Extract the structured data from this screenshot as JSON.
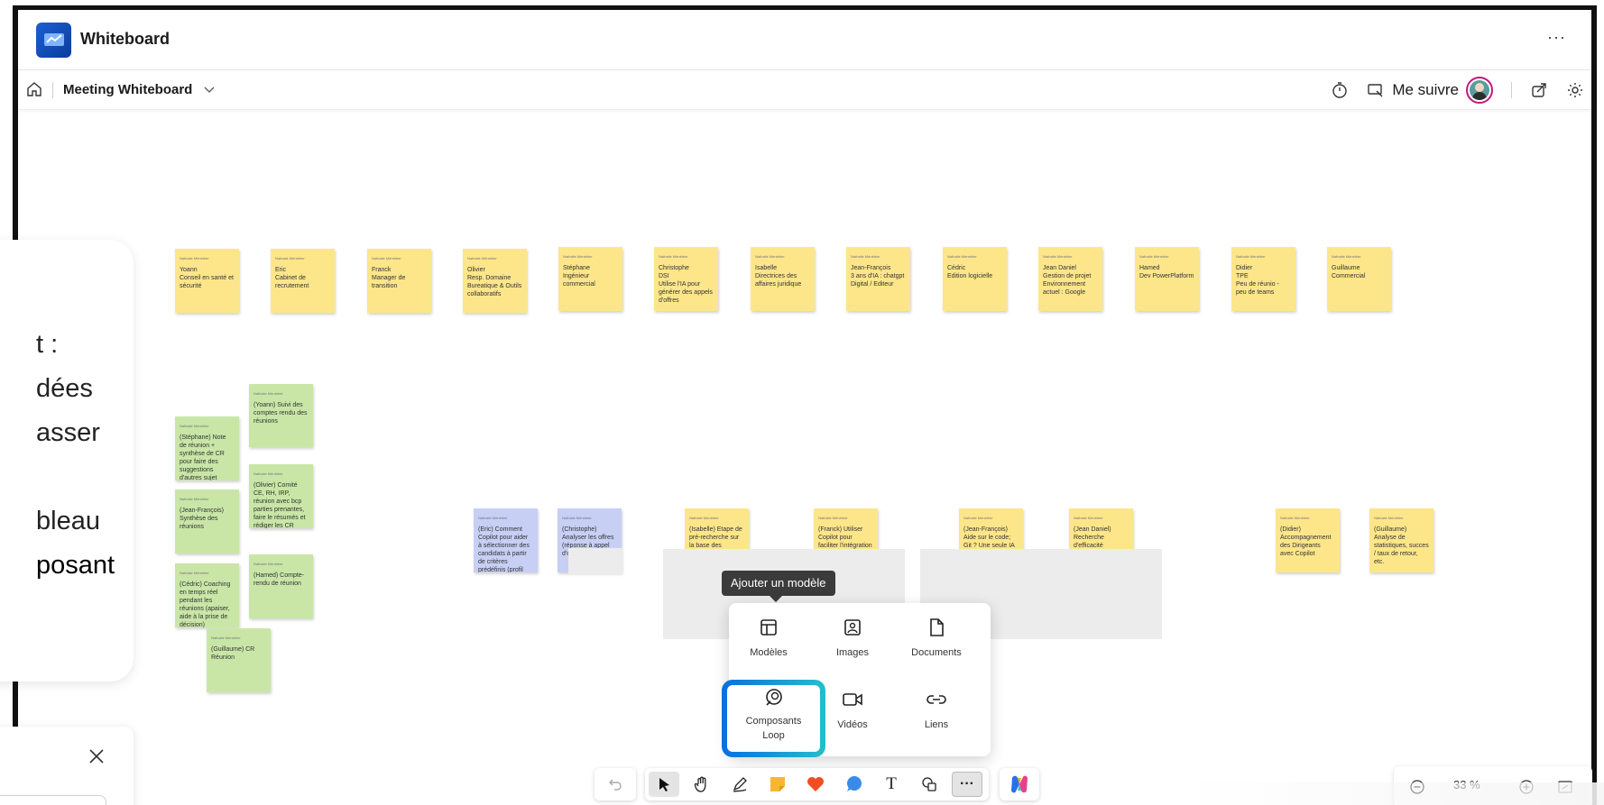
{
  "app": {
    "title": "Whiteboard",
    "more": "···"
  },
  "board": {
    "name": "Meeting Whiteboard",
    "follow_label": "Me suivre"
  },
  "notes_author": "Nathalie Ménétrier",
  "top_notes": [
    "Yoann\nConseil en santé et sécurité",
    "Eric\nCabinet de recrutement",
    "Franck\nManager de transition",
    "Olivier\nResp. Domaine Bureatique & Outils collaboratifs",
    "Stéphane\nIngénieur commercial",
    "Christophe\nDSI\nUtilise l'IA pour générer des appels d'offres",
    "Isabelle\nDirectrices des affaires juridique",
    "Jean-François\n3 ans d'IA : chatgpt\nDigital / Editeur",
    "Cédric\nEdition logicielle",
    "Jean Daniel\nGestion de projet\nEnvironnement actuel : Google",
    "Hamed\nDev PowerPlatform",
    "Didier\nTPE\nPeu de réunio - peu de teams",
    "Guillaume\nCommercial"
  ],
  "green_notes": [
    "(Yoann) Suivi des comptes rendu des réunions",
    "(Stéphane) Note de réunion + synthèse de CR pour faire des suggestions d'autres sujet",
    "(Olivier) Comité CE, RH, IRP, réunion avec bcp parties prenantes, faire le résumés et rédiger les CR",
    "(Jean-François) Synthèse des réunions",
    "(Hamed) Compte-rendu de réunion",
    "(Cédric) Coaching en temps réel pendant les réunions (apaiser, aide à la prise de décision)",
    "(Guillaume) CR Réunion"
  ],
  "blue_notes": [
    "(Eric) Comment Copilot pour aider à sélectionner des candidats à partir de critères prédéfinis (profil défini)",
    "(Christophe) Analyser les offres (réponse à appel d'offre)"
  ],
  "yellow_row_notes": [
    "(Isabelle) Etape de pré-recherche sur la base des données récoltées (données",
    "(Franck) Utiliser Copilot pour faciliter l'intégration dans les entreprises / Se",
    "(Jean-François) Aide sur le code; Git ? Une seule IA qui peut tout gérer ?",
    "(Jean Daniel) Recherche d'efficacité",
    "(Didier) Accompagnement des Dirigeants avec Copilot",
    "(Guillaume) Analyse de statistiques, succes / taux de retour, etc."
  ],
  "side_card": {
    "lines": [
      "t :",
      "dées",
      "asser",
      "bleau",
      "posant"
    ]
  },
  "tooltip": "Ajouter un modèle",
  "popup": {
    "items": [
      {
        "label": "Modèles",
        "icon": "template-icon"
      },
      {
        "label": "Images",
        "icon": "image-icon"
      },
      {
        "label": "Documents",
        "icon": "document-icon"
      },
      {
        "label": "Composants Loop",
        "icon": "loop-icon"
      },
      {
        "label": "Vidéos",
        "icon": "video-icon"
      },
      {
        "label": "Liens",
        "icon": "link-icon"
      }
    ]
  },
  "toolbar": {
    "tools": [
      "undo-icon",
      "select-icon",
      "hand-icon",
      "pen-icon",
      "sticky-note-icon",
      "reaction-heart-icon",
      "comment-icon",
      "text-icon",
      "shapes-icon",
      "more-icon",
      "copilot-icon"
    ],
    "text_tool": "T",
    "more": "···"
  },
  "zoom": {
    "value": "33 %"
  },
  "colors": {
    "yellow_note": "#fde68a",
    "green_note": "#c9e6a7",
    "blue_note": "#c7cff5",
    "loop_highlight": "#0b6ee0",
    "avatar_ring": "#c2187a"
  }
}
